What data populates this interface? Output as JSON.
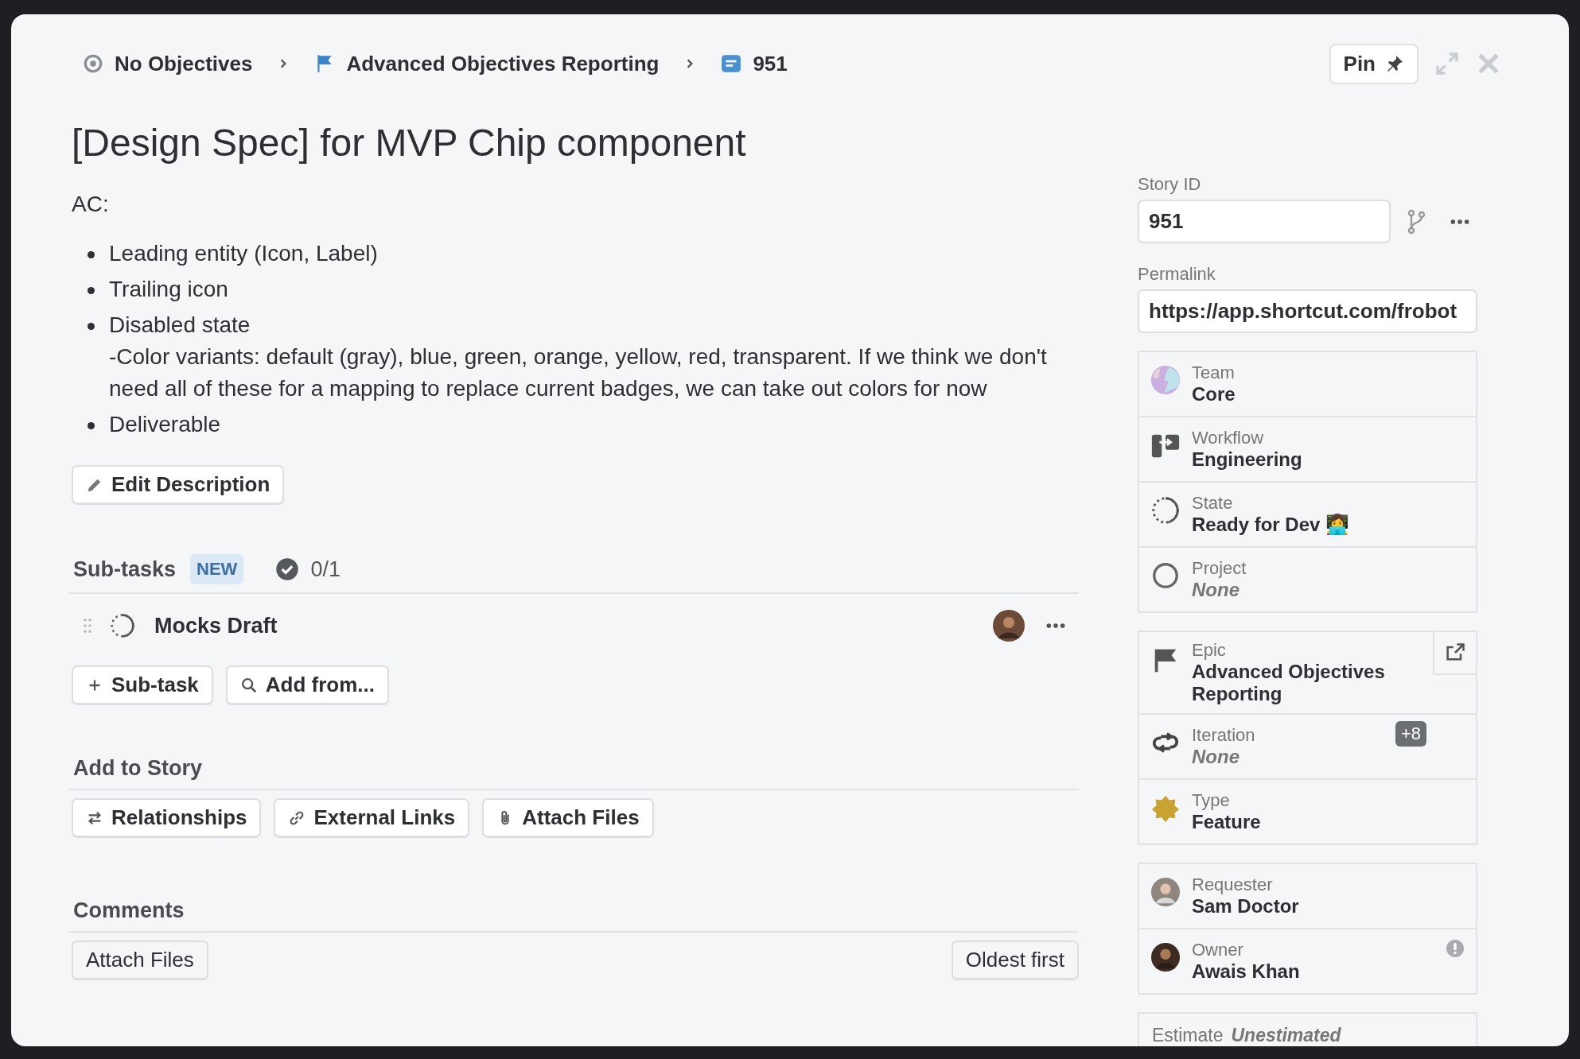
{
  "breadcrumb": [
    {
      "kind": "objective",
      "label": "No Objectives"
    },
    {
      "kind": "epic",
      "label": "Advanced Objectives Reporting"
    },
    {
      "kind": "story",
      "label": "951"
    }
  ],
  "pin_button": "Pin",
  "title": "[Design Spec] for MVP Chip component",
  "description": {
    "intro": "AC:",
    "bullets": [
      {
        "lines": [
          "Leading entity (Icon, Label)"
        ]
      },
      {
        "lines": [
          "Trailing icon"
        ]
      },
      {
        "lines": [
          "Disabled state",
          "-Color variants: default (gray), blue, green, orange, yellow, red, transparent. If we think we don't need all of these for a mapping to replace current badges, we can take out colors for now"
        ]
      },
      {
        "lines": [
          "Deliverable"
        ]
      }
    ]
  },
  "edit_button": "Edit Description",
  "subtasks": {
    "title": "Sub-tasks",
    "badge": "NEW",
    "progress": "0/1",
    "items": [
      {
        "name": "Mocks Draft"
      }
    ],
    "buttons": [
      {
        "kind": "add",
        "label": "Sub-task"
      },
      {
        "kind": "search",
        "label": "Add from..."
      }
    ]
  },
  "add_to_story": {
    "title": "Add to Story",
    "buttons": [
      {
        "kind": "relationships",
        "label": "Relationships"
      },
      {
        "kind": "link",
        "label": "External Links"
      },
      {
        "kind": "attach",
        "label": "Attach Files"
      }
    ]
  },
  "comments": {
    "title": "Comments",
    "attach_button": "Attach Files",
    "sort_button": "Oldest first"
  },
  "sidebar": {
    "story_id": {
      "label": "Story ID",
      "value": "951"
    },
    "permalink": {
      "label": "Permalink",
      "value": "https://app.shortcut.com/frobot"
    },
    "groups": [
      [
        {
          "kind": "team",
          "label": "Team",
          "value": "Core",
          "empty": false
        },
        {
          "kind": "workflow",
          "label": "Workflow",
          "value": "Engineering",
          "empty": false
        },
        {
          "kind": "state",
          "label": "State",
          "value": "Ready for Dev 👩‍💻",
          "empty": false
        },
        {
          "kind": "project",
          "label": "Project",
          "value": "None",
          "empty": true
        }
      ],
      [
        {
          "kind": "epic",
          "label": "Epic",
          "value": "Advanced Objectives Reporting",
          "empty": false
        },
        {
          "kind": "iteration",
          "label": "Iteration",
          "value": "None",
          "empty": true,
          "badge": "+8"
        },
        {
          "kind": "type",
          "label": "Type",
          "value": "Feature",
          "empty": false
        }
      ],
      [
        {
          "kind": "person",
          "label": "Requester",
          "value": "Sam Doctor",
          "empty": false,
          "alert": false
        },
        {
          "kind": "person",
          "label": "Owner",
          "value": "Awais Khan",
          "empty": false,
          "alert": true
        }
      ]
    ],
    "estimate": {
      "label": "Estimate",
      "value": "Unestimated"
    }
  }
}
